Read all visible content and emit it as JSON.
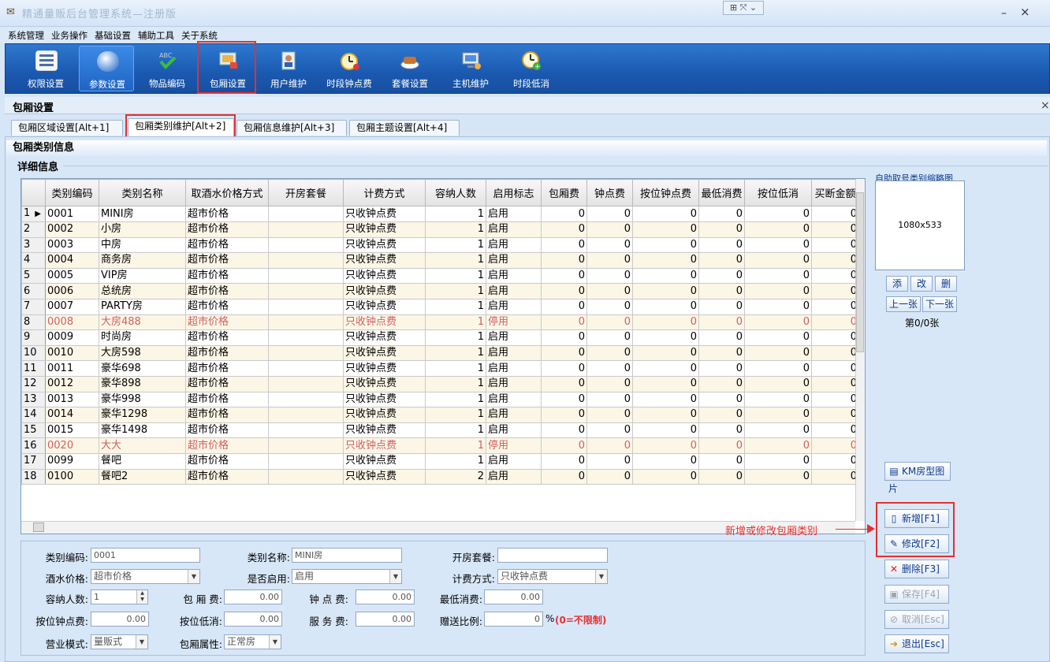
{
  "window": {
    "title": "精通量贩后台管理系统—注册版",
    "minimize_glyph": "–",
    "close_glyph": "×",
    "tools_glyph": "⊞ ⤧ ⌄"
  },
  "menu": [
    "系统管理",
    "业务操作",
    "基础设置",
    "辅助工具",
    "关于系统"
  ],
  "toolbar": [
    {
      "label": "权限设置",
      "icon": "permissions-icon"
    },
    {
      "label": "参数设置",
      "icon": "parameters-icon"
    },
    {
      "label": "物品编码",
      "icon": "item-code-icon"
    },
    {
      "label": "包厢设置",
      "icon": "room-settings-icon"
    },
    {
      "label": "用户维护",
      "icon": "user-maintenance-icon"
    },
    {
      "label": "时段钟点费",
      "icon": "hourly-fee-icon"
    },
    {
      "label": "套餐设置",
      "icon": "package-icon"
    },
    {
      "label": "主机维护",
      "icon": "host-icon"
    },
    {
      "label": "时段低消",
      "icon": "min-consumption-icon"
    }
  ],
  "subwindow": {
    "title": "包厢设置",
    "close_glyph": "×"
  },
  "tabs": [
    "包厢区域设置[Alt+1]",
    "包厢类别维护[Alt+2]",
    "包厢信息维护[Alt+3]",
    "包厢主题设置[Alt+4]"
  ],
  "section_title": "包厢类别信息",
  "detail_title": "详细信息",
  "grid": {
    "columns": [
      "类别编码",
      "类别名称",
      "取酒水价格方式",
      "开房套餐",
      "计费方式",
      "容纳人数",
      "启用标志",
      "包厢费",
      "钟点费",
      "按位钟点费",
      "最低消费",
      "按位低消",
      "买断金额"
    ],
    "rows": [
      [
        "1",
        "0001",
        "MINI房",
        "超市价格",
        "",
        "只收钟点费",
        "1",
        "启用",
        "0",
        "0",
        "0",
        "0",
        "0",
        "0"
      ],
      [
        "2",
        "0002",
        "小房",
        "超市价格",
        "",
        "只收钟点费",
        "1",
        "启用",
        "0",
        "0",
        "0",
        "0",
        "0",
        "0"
      ],
      [
        "3",
        "0003",
        "中房",
        "超市价格",
        "",
        "只收钟点费",
        "1",
        "启用",
        "0",
        "0",
        "0",
        "0",
        "0",
        "0"
      ],
      [
        "4",
        "0004",
        "商务房",
        "超市价格",
        "",
        "只收钟点费",
        "1",
        "启用",
        "0",
        "0",
        "0",
        "0",
        "0",
        "0"
      ],
      [
        "5",
        "0005",
        "VIP房",
        "超市价格",
        "",
        "只收钟点费",
        "1",
        "启用",
        "0",
        "0",
        "0",
        "0",
        "0",
        "0"
      ],
      [
        "6",
        "0006",
        "总统房",
        "超市价格",
        "",
        "只收钟点费",
        "1",
        "启用",
        "0",
        "0",
        "0",
        "0",
        "0",
        "0"
      ],
      [
        "7",
        "0007",
        "PARTY房",
        "超市价格",
        "",
        "只收钟点费",
        "1",
        "启用",
        "0",
        "0",
        "0",
        "0",
        "0",
        "0"
      ],
      [
        "8",
        "0008",
        "大房488",
        "超市价格",
        "",
        "只收钟点费",
        "1",
        "停用",
        "0",
        "0",
        "0",
        "0",
        "0",
        "0"
      ],
      [
        "9",
        "0009",
        "时尚房",
        "超市价格",
        "",
        "只收钟点费",
        "1",
        "启用",
        "0",
        "0",
        "0",
        "0",
        "0",
        "0"
      ],
      [
        "10",
        "0010",
        "大房598",
        "超市价格",
        "",
        "只收钟点费",
        "1",
        "启用",
        "0",
        "0",
        "0",
        "0",
        "0",
        "0"
      ],
      [
        "11",
        "0011",
        "豪华698",
        "超市价格",
        "",
        "只收钟点费",
        "1",
        "启用",
        "0",
        "0",
        "0",
        "0",
        "0",
        "0"
      ],
      [
        "12",
        "0012",
        "豪华898",
        "超市价格",
        "",
        "只收钟点费",
        "1",
        "启用",
        "0",
        "0",
        "0",
        "0",
        "0",
        "0"
      ],
      [
        "13",
        "0013",
        "豪华998",
        "超市价格",
        "",
        "只收钟点费",
        "1",
        "启用",
        "0",
        "0",
        "0",
        "0",
        "0",
        "0"
      ],
      [
        "14",
        "0014",
        "豪华1298",
        "超市价格",
        "",
        "只收钟点费",
        "1",
        "启用",
        "0",
        "0",
        "0",
        "0",
        "0",
        "0"
      ],
      [
        "15",
        "0015",
        "豪华1498",
        "超市价格",
        "",
        "只收钟点费",
        "1",
        "启用",
        "0",
        "0",
        "0",
        "0",
        "0",
        "0"
      ],
      [
        "16",
        "0020",
        "大大",
        "超市价格",
        "",
        "只收钟点费",
        "1",
        "停用",
        "0",
        "0",
        "0",
        "0",
        "0",
        "0"
      ],
      [
        "17",
        "0099",
        "餐吧",
        "超市价格",
        "",
        "只收钟点费",
        "1",
        "启用",
        "0",
        "0",
        "0",
        "0",
        "0",
        "0"
      ],
      [
        "18",
        "0100",
        "餐吧2",
        "超市价格",
        "",
        "只收钟点费",
        "2",
        "启用",
        "0",
        "0",
        "0",
        "0",
        "0",
        "0"
      ]
    ],
    "current_row_marker": "▶"
  },
  "thumbnail": {
    "label": "自助取号类别缩略图",
    "size_text": "1080x533",
    "add": "添",
    "edit": "改",
    "delete": "删",
    "prev": "上一张",
    "next": "下一张",
    "page": "第0/0张"
  },
  "side_buttons": {
    "km_image": "KM房型图片",
    "add": "新增[F1]",
    "modify": "修改[F2]",
    "delete": "删除[F3]",
    "save": "保存[F4]",
    "cancel": "取消[Esc]",
    "exit": "退出[Esc]"
  },
  "annotation": "新增或修改包厢类别",
  "form": {
    "code_label": "类别编码:",
    "code_value": "0001",
    "name_label": "类别名称:",
    "name_value": "MINI房",
    "package_label": "开房套餐:",
    "package_value": "",
    "drink_label": "酒水价格:",
    "drink_value": "超市价格",
    "enabled_label": "是否启用:",
    "enabled_value": "启用",
    "billing_label": "计费方式:",
    "billing_value": "只收钟点费",
    "capacity_label": "容纳人数:",
    "capacity_value": "1",
    "room_fee_label": "包 厢 费:",
    "room_fee_value": "0.00",
    "hour_fee_label": "钟 点 费:",
    "hour_fee_value": "0.00",
    "min_consume_label": "最低消费:",
    "min_consume_value": "0.00",
    "seat_hour_label": "按位钟点费:",
    "seat_hour_value": "0.00",
    "seat_min_label": "按位低消:",
    "seat_min_value": "0.00",
    "service_label": "服 务 费:",
    "service_value": "0.00",
    "gift_label": "赠送比例:",
    "gift_value": "0",
    "percent": "%",
    "no_limit": "(0=不限制)",
    "mode_label": "营业模式:",
    "mode_value": "量贩式",
    "attr_label": "包厢属性:",
    "attr_value": "正常房"
  }
}
